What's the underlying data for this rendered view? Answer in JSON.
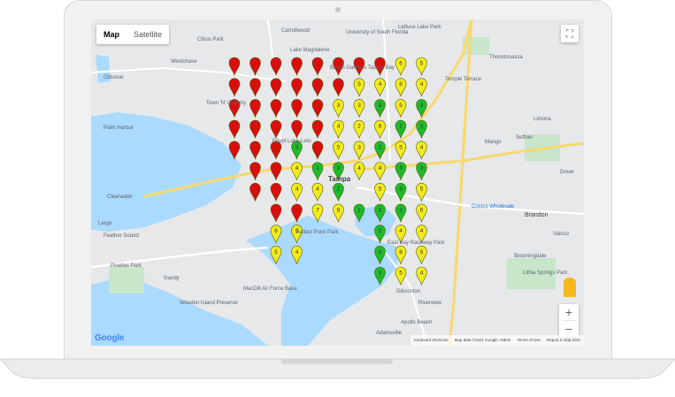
{
  "map_type": {
    "options": [
      "Map",
      "Satellite"
    ],
    "selected": "Map"
  },
  "controls": {
    "fullscreen_icon": "fullscreen-icon",
    "zoom_in": "+",
    "zoom_out": "−",
    "street_view_icon": "pegman-icon"
  },
  "google_logo": "Google",
  "attribution": [
    "Keyboard shortcuts",
    "Map data ©2021 Google, INEGI",
    "Terms of Use",
    "Report a map error"
  ],
  "place_labels": [
    "Westchase",
    "Oldsmar",
    "Town 'N' Country",
    "Palm Harbor",
    "Tampa",
    "Brandon",
    "Mango",
    "Seffner",
    "Valrico",
    "Clearwater",
    "Largo",
    "Feather Sound",
    "Pinellas Park",
    "Gandy",
    "MacDill Air Force Base",
    "Riverview",
    "Gibsonton",
    "Bloomingdale",
    "Lithia Springs Park",
    "Apollo Beach",
    "Adamsville",
    "Lettuce Lake Park",
    "University of South Florida",
    "Costco Wholesale",
    "East Bay Raceway Park",
    "Ballast Point Park",
    "Busch Gardens Tampa Bay",
    "Weedon Island Preserve",
    "Limona",
    "Dover",
    "Thonotosassa",
    "Temple Terrace",
    "Lake Magdalene",
    "Citrus Park",
    "Carrollwood",
    "Egypt Lake-Leto"
  ],
  "pin_colors": {
    "red": "#d90e0e",
    "yellow": "#f2ec1d",
    "green": "#1dbb2a"
  },
  "pins": [
    [
      "R",
      "R",
      "R",
      "R",
      "R",
      "R",
      "R",
      "R",
      "Y",
      "Y"
    ],
    [
      "R",
      "R",
      "R",
      "R",
      "R",
      "R",
      "Y",
      "Y",
      "Y",
      "Y"
    ],
    [
      "R",
      "R",
      "R",
      "R",
      "R",
      "Y",
      "Y",
      "G",
      "Y",
      "G"
    ],
    [
      "R",
      "R",
      "R",
      "R",
      "R",
      "Y",
      "Y",
      "Y",
      "G",
      "G"
    ],
    [
      "R",
      "R",
      "R",
      "G",
      "R",
      "Y",
      "Y",
      "G",
      "Y",
      "Y"
    ],
    [
      "-",
      "R",
      "R",
      "Y",
      "G",
      "G",
      "Y",
      "Y",
      "G",
      "G"
    ],
    [
      "-",
      "R",
      "R",
      "Y",
      "Y",
      "G",
      "-",
      "Y",
      "G",
      "Y"
    ],
    [
      "-",
      "-",
      "R",
      "R",
      "Y",
      "Y",
      "G",
      "G",
      "G",
      "Y"
    ],
    [
      "-",
      "-",
      "Y",
      "Y",
      "-",
      "-",
      "-",
      "G",
      "Y",
      "Y"
    ],
    [
      "-",
      "-",
      "Y",
      "Y",
      "-",
      "-",
      "-",
      "G",
      "Y",
      "Y"
    ],
    [
      "-",
      "-",
      "-",
      "-",
      "-",
      "-",
      "-",
      "G",
      "Y",
      "Y"
    ]
  ],
  "pin_labels": {
    "R": "",
    "Y": [
      "6",
      "5",
      "5",
      "4",
      "6",
      "4",
      "3",
      "3",
      "5",
      "4",
      "2",
      "6",
      "5",
      "3",
      "5",
      "4",
      "4",
      "4",
      "4",
      "4",
      "4",
      "5",
      "5",
      "7",
      "8",
      "6",
      "6",
      "5",
      "4",
      "4",
      "5",
      "4"
    ],
    "G": [
      "3",
      "3",
      "2",
      "3",
      "3",
      "2",
      "1",
      "3",
      "3",
      "3",
      "2",
      "3",
      "2",
      "3",
      "3",
      "2",
      "3",
      "3",
      "3",
      "2",
      "3"
    ]
  }
}
